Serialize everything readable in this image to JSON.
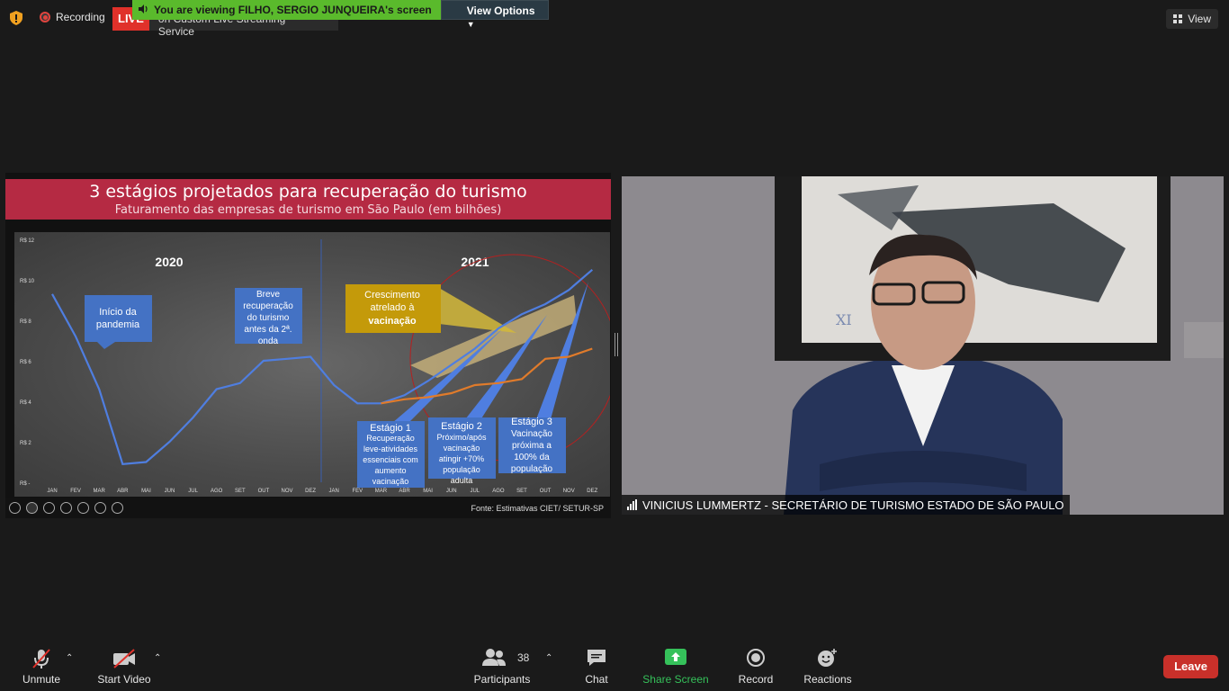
{
  "top": {
    "recording_label": "Recording",
    "live_badge": "LIVE",
    "live_service": "on Custom Live Streaming Service",
    "viewing_banner": "You are viewing FILHO, SERGIO JUNQUEIRA's screen",
    "view_options": "View Options",
    "view_label": "View"
  },
  "slide": {
    "title": "3 estágios projetados para recuperação do turismo",
    "subtitle": "Faturamento das empresas de turismo em São Paulo (em bilhões)",
    "source": "Fonte: Estimativas CIET/ SETUR-SP",
    "years": [
      "2020",
      "2021"
    ],
    "callouts": {
      "inicio": "Início da pandemia",
      "breve": "Breve recuperação do turismo antes da 2ª. onda",
      "crescimento_1": "Crescimento atrelado à",
      "crescimento_2": "vacinação",
      "estagio1_title": "Estágio 1",
      "estagio1_text": "Recuperação leve-atividades essenciais com aumento vacinação",
      "estagio2_title": "Estágio 2",
      "estagio2_text": "Próximo/após vacinação atingir +70% população adulta",
      "estagio3_title": "Estágio 3",
      "estagio3_text": "Vacinação próxima a 100% da população"
    }
  },
  "chart_data": {
    "type": "line",
    "title": "",
    "xlabel": "",
    "ylabel": "",
    "y_ticks": [
      "R$ -",
      "R$ 2",
      "R$ 4",
      "R$ 6",
      "R$ 8",
      "R$ 10",
      "R$ 12"
    ],
    "ylim": [
      0,
      12
    ],
    "categories": [
      "JAN",
      "FEV",
      "MAR",
      "ABR",
      "MAI",
      "JUN",
      "JUL",
      "AGO",
      "SET",
      "OUT",
      "NOV",
      "DEZ",
      "JAN",
      "FEV",
      "MAR",
      "ABR",
      "MAI",
      "JUN",
      "JUL",
      "AGO",
      "SET",
      "OUT",
      "NOV",
      "DEZ"
    ],
    "series": [
      {
        "color": "#4f7ee0",
        "values": [
          9.3,
          7.2,
          4.6,
          0.9,
          1.0,
          2.0,
          3.2,
          4.6,
          4.9,
          6.0,
          6.1,
          6.2,
          4.8,
          3.9,
          3.9,
          4.3,
          5.0,
          5.8,
          6.6,
          7.6,
          8.3,
          8.8,
          9.5,
          10.5
        ]
      },
      {
        "color": "#e07b2b",
        "values": [
          null,
          null,
          null,
          null,
          null,
          null,
          null,
          null,
          null,
          null,
          null,
          null,
          null,
          null,
          3.9,
          4.1,
          4.2,
          4.4,
          4.8,
          4.9,
          5.1,
          6.1,
          6.2,
          6.6
        ]
      }
    ]
  },
  "speaker": {
    "name": "VINICIUS LUMMERTZ - SECRETÁRIO DE TURISMO ESTADO DE SÃO PAULO"
  },
  "toolbar": {
    "unmute": "Unmute",
    "start_video": "Start Video",
    "participants": "Participants",
    "participant_count": "38",
    "chat": "Chat",
    "share_screen": "Share Screen",
    "record": "Record",
    "reactions": "Reactions",
    "leave": "Leave"
  }
}
